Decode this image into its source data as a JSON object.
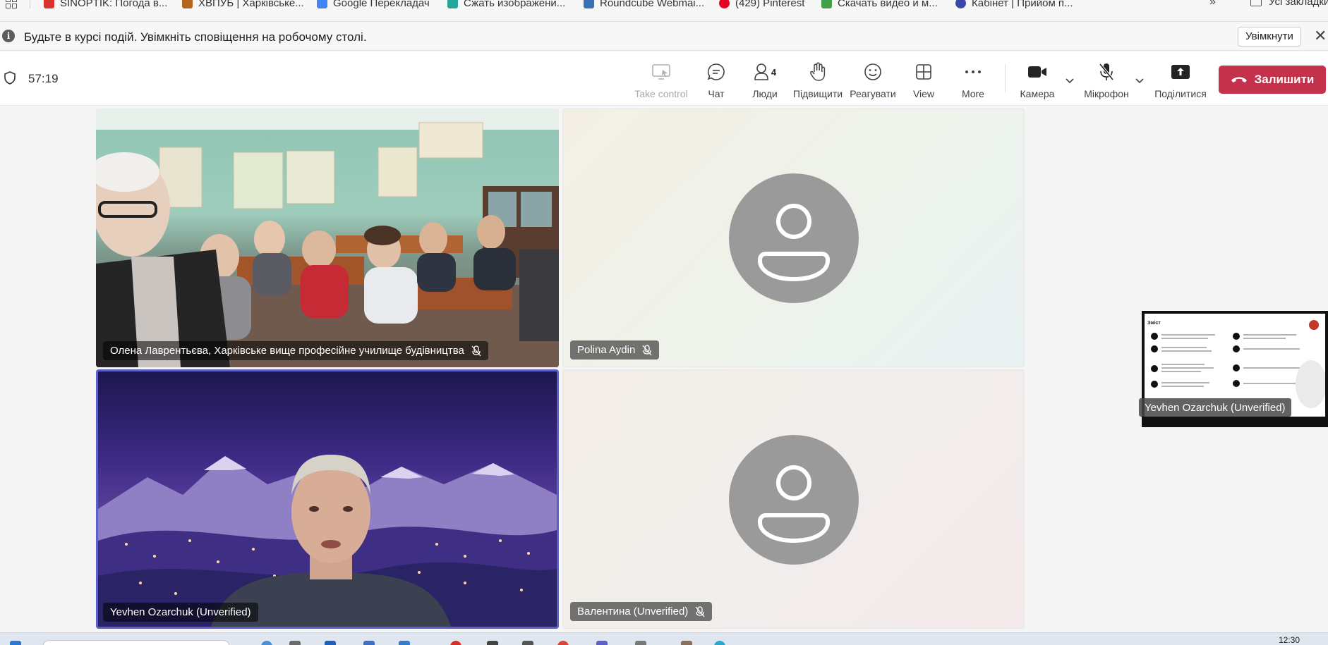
{
  "bookmarks": {
    "items": [
      {
        "label": "SINOPTIK: Погода в...",
        "icon": "thermometer-icon",
        "color": "#d9342b"
      },
      {
        "label": "ХВПУБ | Харківське...",
        "icon": "school-icon",
        "color": "#b5651d"
      },
      {
        "label": "Google Перекладач",
        "icon": "translate-icon",
        "color": "#4285f4"
      },
      {
        "label": "Сжать изображени...",
        "icon": "compress-icon",
        "color": "#26a69a"
      },
      {
        "label": "Roundcube Webmai...",
        "icon": "mail-icon",
        "color": "#3b6fb6"
      },
      {
        "label": "(429) Pinterest",
        "icon": "pinterest-icon",
        "color": "#e60023"
      },
      {
        "label": "Скачать видео и м...",
        "icon": "download-icon",
        "color": "#43a047"
      },
      {
        "label": "Кабінет | Прийом п...",
        "icon": "account-icon",
        "color": "#3949ab"
      }
    ],
    "more": "»",
    "all_bookmarks": "Усі закладки"
  },
  "notification": {
    "text": "Будьте в курсі подій. Увімкніть сповіщення на робочому столі.",
    "button": "Увімкнути"
  },
  "toolbar": {
    "timer": "57:19",
    "take_control": "Take control",
    "chat": "Чат",
    "people": "Люди",
    "people_count": "4",
    "raise": "Підвищити",
    "react": "Реагувати",
    "view": "View",
    "more": "More",
    "camera": "Камера",
    "mic": "Мікрофон",
    "share": "Поділитися",
    "leave": "Залишити",
    "leave_color": "#c4314b"
  },
  "participants": [
    {
      "name": "Олена Лаврентьєва, Харківське вище професійне училище будівництва",
      "muted": true,
      "video": true
    },
    {
      "name": "Polina Aydin",
      "muted": true,
      "video": false
    },
    {
      "name": "Yevhen Ozarchuk (Unverified)",
      "muted": false,
      "video": true,
      "active_speaker": true
    },
    {
      "name": "Валентина (Unverified)",
      "muted": true,
      "video": false
    }
  ],
  "screen_share": {
    "presenter": "Yevhen Ozarchuk (Unverified)",
    "slide_title": "Зміст"
  },
  "taskbar": {
    "clock": "12:30"
  }
}
